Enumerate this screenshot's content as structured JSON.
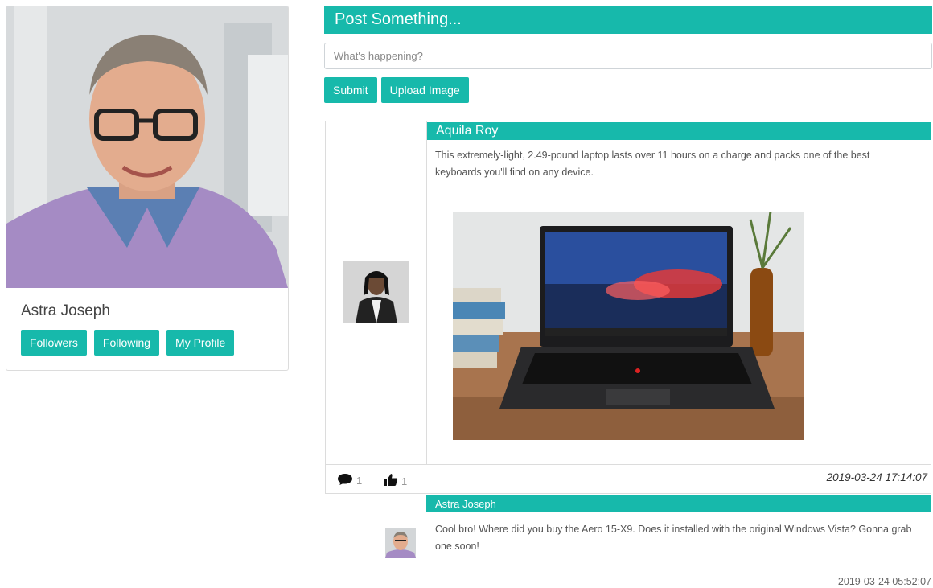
{
  "profile": {
    "name": "Astra Joseph",
    "buttons": [
      "Followers",
      "Following",
      "My Profile"
    ]
  },
  "post_form": {
    "header": "Post Something...",
    "placeholder": "What's happening?",
    "submit_label": "Submit",
    "upload_label": "Upload Image"
  },
  "post": {
    "author": "Aquila Roy",
    "text": "This extremely-light, 2.49-pound laptop lasts over 11 hours on a charge and packs one of the best keyboards you'll find on any device.",
    "comment_count": "1",
    "like_count": "1",
    "timestamp": "2019-03-24 17:14:07"
  },
  "comment": {
    "author": "Astra Joseph",
    "text": "Cool bro! Where did you buy the Aero 15-X9. Does it installed with the original Windows Vista? Gonna grab one soon!",
    "timestamp": "2019-03-24 05:52:07"
  },
  "colors": {
    "accent": "#17b9ab"
  },
  "icons": {
    "comment": "comment-icon",
    "like": "thumbs-up-icon"
  }
}
